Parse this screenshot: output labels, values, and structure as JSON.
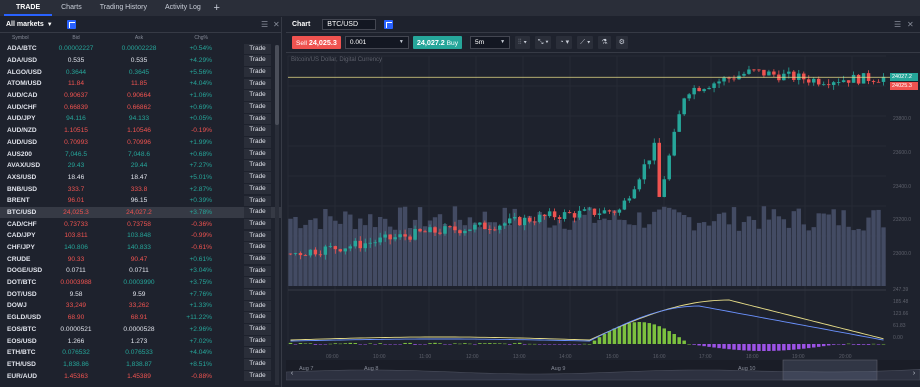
{
  "nav": {
    "tabs": [
      "TRADE",
      "Charts",
      "Trading History",
      "Activity Log"
    ],
    "add_icon": "plus-icon"
  },
  "market_panel": {
    "filter_label": "All markets",
    "columns": [
      "Symbol",
      "Bid",
      "Ask",
      "Chg%"
    ],
    "trade_label": "Trade",
    "rows": [
      {
        "symbol": "ADA/BTC",
        "bid": "0.00002227",
        "ask": "0.00002228",
        "chg": "+0.54%",
        "bid_c": "up",
        "ask_c": "up",
        "chg_c": "up"
      },
      {
        "symbol": "ADA/USD",
        "bid": "0.535",
        "ask": "0.535",
        "chg": "+4.29%",
        "bid_c": "nt",
        "ask_c": "nt",
        "chg_c": "up"
      },
      {
        "symbol": "ALGO/USD",
        "bid": "0.3644",
        "ask": "0.3645",
        "chg": "+5.56%",
        "bid_c": "up",
        "ask_c": "up",
        "chg_c": "up"
      },
      {
        "symbol": "ATOM/USD",
        "bid": "11.84",
        "ask": "11.85",
        "chg": "+4.04%",
        "bid_c": "dn",
        "ask_c": "dn",
        "chg_c": "up"
      },
      {
        "symbol": "AUD/CAD",
        "bid": "0.90637",
        "ask": "0.90664",
        "chg": "+1.06%",
        "bid_c": "dn",
        "ask_c": "dn",
        "chg_c": "up"
      },
      {
        "symbol": "AUD/CHF",
        "bid": "0.66839",
        "ask": "0.66862",
        "chg": "+0.69%",
        "bid_c": "dn",
        "ask_c": "dn",
        "chg_c": "up"
      },
      {
        "symbol": "AUD/JPY",
        "bid": "94.116",
        "ask": "94.133",
        "chg": "+0.05%",
        "bid_c": "up",
        "ask_c": "up",
        "chg_c": "up"
      },
      {
        "symbol": "AUD/NZD",
        "bid": "1.10515",
        "ask": "1.10546",
        "chg": "-0.19%",
        "bid_c": "dn",
        "ask_c": "dn",
        "chg_c": "dn"
      },
      {
        "symbol": "AUD/USD",
        "bid": "0.70993",
        "ask": "0.70996",
        "chg": "+1.99%",
        "bid_c": "dn",
        "ask_c": "dn",
        "chg_c": "up"
      },
      {
        "symbol": "AUS200",
        "bid": "7,046.5",
        "ask": "7,048.6",
        "chg": "+0.68%",
        "bid_c": "up",
        "ask_c": "up",
        "chg_c": "up"
      },
      {
        "symbol": "AVAX/USD",
        "bid": "29.43",
        "ask": "29.44",
        "chg": "+7.27%",
        "bid_c": "up",
        "ask_c": "up",
        "chg_c": "up"
      },
      {
        "symbol": "AXS/USD",
        "bid": "18.46",
        "ask": "18.47",
        "chg": "+5.01%",
        "bid_c": "nt",
        "ask_c": "nt",
        "chg_c": "up"
      },
      {
        "symbol": "BNB/USD",
        "bid": "333.7",
        "ask": "333.8",
        "chg": "+2.87%",
        "bid_c": "dn",
        "ask_c": "dn",
        "chg_c": "up"
      },
      {
        "symbol": "BRENT",
        "bid": "96.01",
        "ask": "96.15",
        "chg": "+0.39%",
        "bid_c": "dn",
        "ask_c": "nt",
        "chg_c": "up"
      },
      {
        "symbol": "BTC/USD",
        "bid": "24,025.3",
        "ask": "24,027.2",
        "chg": "+3.78%",
        "bid_c": "dn",
        "ask_c": "dn",
        "chg_c": "up"
      },
      {
        "symbol": "CAD/CHF",
        "bid": "0.73733",
        "ask": "0.73758",
        "chg": "-0.36%",
        "bid_c": "dn",
        "ask_c": "dn",
        "chg_c": "dn"
      },
      {
        "symbol": "CAD/JPY",
        "bid": "103.811",
        "ask": "103.848",
        "chg": "-0.99%",
        "bid_c": "dn",
        "ask_c": "up",
        "chg_c": "dn"
      },
      {
        "symbol": "CHF/JPY",
        "bid": "140.806",
        "ask": "140.833",
        "chg": "-0.61%",
        "bid_c": "up",
        "ask_c": "up",
        "chg_c": "dn"
      },
      {
        "symbol": "CRUDE",
        "bid": "90.33",
        "ask": "90.47",
        "chg": "+0.61%",
        "bid_c": "dn",
        "ask_c": "dn",
        "chg_c": "up"
      },
      {
        "symbol": "DOGE/USD",
        "bid": "0.0711",
        "ask": "0.0711",
        "chg": "+3.04%",
        "bid_c": "nt",
        "ask_c": "nt",
        "chg_c": "up"
      },
      {
        "symbol": "DOT/BTC",
        "bid": "0.0003988",
        "ask": "0.0003990",
        "chg": "+3.75%",
        "bid_c": "dn",
        "ask_c": "up",
        "chg_c": "up"
      },
      {
        "symbol": "DOT/USD",
        "bid": "9.58",
        "ask": "9.59",
        "chg": "+7.76%",
        "bid_c": "nt",
        "ask_c": "nt",
        "chg_c": "up"
      },
      {
        "symbol": "DOWJ",
        "bid": "33,249",
        "ask": "33,262",
        "chg": "+1.33%",
        "bid_c": "dn",
        "ask_c": "dn",
        "chg_c": "up"
      },
      {
        "symbol": "EGLD/USD",
        "bid": "68.90",
        "ask": "68.91",
        "chg": "+11.22%",
        "bid_c": "dn",
        "ask_c": "dn",
        "chg_c": "up"
      },
      {
        "symbol": "EOS/BTC",
        "bid": "0.0000521",
        "ask": "0.0000528",
        "chg": "+2.96%",
        "bid_c": "nt",
        "ask_c": "nt",
        "chg_c": "up"
      },
      {
        "symbol": "EOS/USD",
        "bid": "1.266",
        "ask": "1.273",
        "chg": "+7.02%",
        "bid_c": "nt",
        "ask_c": "nt",
        "chg_c": "up"
      },
      {
        "symbol": "ETH/BTC",
        "bid": "0.076532",
        "ask": "0.076533",
        "chg": "+4.04%",
        "bid_c": "up",
        "ask_c": "up",
        "chg_c": "up"
      },
      {
        "symbol": "ETH/USD",
        "bid": "1,838.86",
        "ask": "1,838.87",
        "chg": "+8.51%",
        "bid_c": "up",
        "ask_c": "up",
        "chg_c": "up"
      },
      {
        "symbol": "EUR/AUD",
        "bid": "1.45363",
        "ask": "1.45389",
        "chg": "-0.88%",
        "bid_c": "dn",
        "ask_c": "dn",
        "chg_c": "dn"
      }
    ],
    "selected_row": "BTC/USD"
  },
  "chart_panel": {
    "title": "Chart",
    "symbol": "BTC/USD",
    "sell_label": "Sell",
    "sell_price": "24,025.3",
    "quantity": "0.001",
    "buy_price": "24,027.2",
    "buy_label": "Buy",
    "timeframe": "5m",
    "description": "Bitcoin/US Dollar, Digital Currency",
    "price_tags": {
      "ask": "24027.2",
      "bid": "24025.3"
    },
    "y_ticks": [
      "23800.0",
      "23600.0",
      "23400.0",
      "23200.0",
      "23000.0"
    ],
    "indicator_ticks": [
      "247.39",
      "185.48",
      "123.66",
      "61.83",
      "0.00"
    ],
    "x_ticks": [
      "09:00",
      "10:00",
      "11:00",
      "12:00",
      "13:00",
      "14:00",
      "15:00",
      "16:00",
      "17:00",
      "18:00",
      "19:00",
      "20:00"
    ],
    "navigator_labels": [
      "Aug 7",
      "Aug 8",
      "Aug 9",
      "Aug 10"
    ],
    "colors": {
      "up": "#26a69a",
      "down": "#ef5350",
      "volume": "#434b63",
      "macd_up": "#7cc13f",
      "macd_down": "#9c52e6",
      "line_a": "#e6dc87",
      "line_b": "#6b92ff",
      "bg": "#1e222d"
    }
  },
  "chart_data": {
    "type": "candlestick",
    "symbol": "BTC/USD",
    "x": [
      "09:00",
      "10:00",
      "11:00",
      "12:00",
      "13:00",
      "14:00",
      "15:00",
      "16:00",
      "17:00",
      "18:00"
    ],
    "close": [
      23010,
      23060,
      23130,
      23170,
      23230,
      23260,
      23950,
      24060,
      24010,
      24026
    ],
    "ylim": [
      22950,
      24150
    ],
    "ask_price": 24027.2,
    "bid_price": 24025.3
  }
}
